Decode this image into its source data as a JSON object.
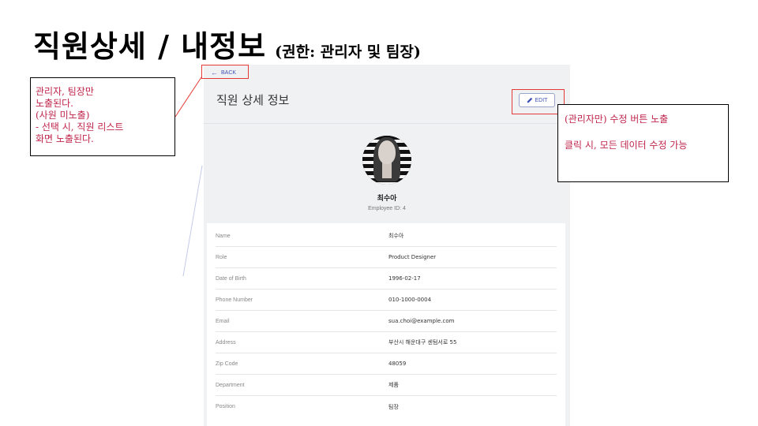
{
  "slide": {
    "title": "직원상세 / 내정보",
    "subtitle": "(권한: 관리자 및 팀장)"
  },
  "app": {
    "back_label": "BACK",
    "page_title": "직원 상세 정보",
    "edit_label": "EDIT",
    "profile": {
      "name": "최수아",
      "employee_id": "Employee ID: 4"
    },
    "fields": [
      {
        "label": "Name",
        "value": "최수아"
      },
      {
        "label": "Role",
        "value": "Product Designer"
      },
      {
        "label": "Date of Birth",
        "value": "1996-02-17"
      },
      {
        "label": "Phone Number",
        "value": "010-1000-0004"
      },
      {
        "label": "Email",
        "value": "sua.choi@example.com"
      },
      {
        "label": "Address",
        "value": "부산시 해운대구 센텀서로 55"
      },
      {
        "label": "Zip Code",
        "value": "48059"
      },
      {
        "label": "Department",
        "value": "제품"
      },
      {
        "label": "Position",
        "value": "팀장"
      }
    ]
  },
  "notes": {
    "left": [
      "관리자, 팀장만",
      "노출된다.",
      "(사원 미노출)",
      "- 선택 시, 직원 리스트",
      "화면 노출된다."
    ],
    "right": [
      "(관리자만) 수정 버튼 노출",
      "클릭 시, 모든 데이터 수정 가능"
    ]
  },
  "icons": {
    "back": "arrow-left-icon",
    "edit": "pencil-icon"
  },
  "colors": {
    "accent": "#3f51b5",
    "annotation_text": "#c0264c",
    "highlight": "#e53935"
  }
}
